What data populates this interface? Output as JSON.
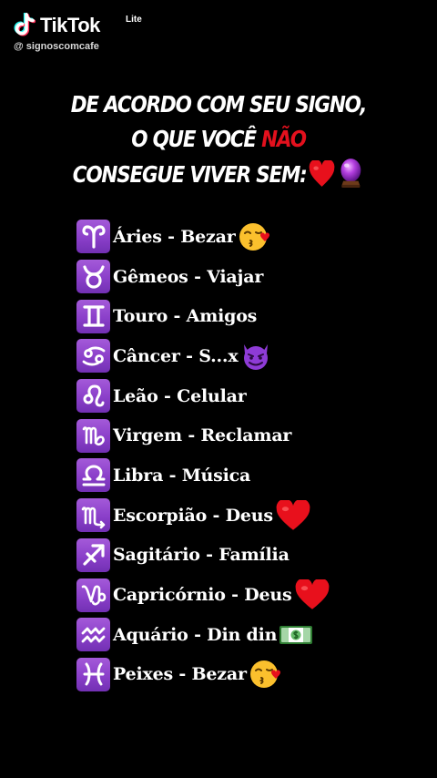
{
  "watermark": {
    "brand": "TikTok",
    "edition": "Lite",
    "handle": "@ signoscomcafe",
    "logo_icon": "tiktok-note-icon"
  },
  "headline": {
    "line1": "DE ACORDO COM SEU SIGNO,",
    "line2_prefix": "O QUE VOCÊ ",
    "line2_highlight": "NÃO",
    "line3": "CONSEGUE VIVER SEM:",
    "line3_emojis": [
      "red-heart-icon",
      "crystal-ball-icon"
    ],
    "highlight_color": "#e3101d"
  },
  "signs": [
    {
      "name": "Áries",
      "answer": "Bezar",
      "glyph": "aries-icon",
      "emoji": "kissing-face-icon"
    },
    {
      "name": "Gêmeos",
      "answer": "Viajar",
      "glyph": "taurus-icon",
      "emoji": ""
    },
    {
      "name": "Touro",
      "answer": "Amigos",
      "glyph": "gemini-icon",
      "emoji": ""
    },
    {
      "name": "Câncer",
      "answer": "S...x",
      "glyph": "cancer-icon",
      "emoji": "smiling-devil-icon"
    },
    {
      "name": "Leão",
      "answer": "Celular",
      "glyph": "leo-icon",
      "emoji": ""
    },
    {
      "name": "Virgem",
      "answer": "Reclamar",
      "glyph": "virgo-icon",
      "emoji": ""
    },
    {
      "name": "Libra",
      "answer": "Música",
      "glyph": "libra-icon",
      "emoji": ""
    },
    {
      "name": "Escorpião",
      "answer": "Deus",
      "glyph": "scorpio-icon",
      "emoji": "red-heart-icon"
    },
    {
      "name": "Sagitário",
      "answer": "Família",
      "glyph": "sagittarius-icon",
      "emoji": ""
    },
    {
      "name": "Capricórnio",
      "answer": "Deus",
      "glyph": "capricorn-icon",
      "emoji": "red-heart-icon"
    },
    {
      "name": "Aquário",
      "answer": "Din din",
      "glyph": "aquarius-icon",
      "emoji": "dollar-banknote-icon"
    },
    {
      "name": "Peixes",
      "answer": "Bezar",
      "glyph": "pisces-icon",
      "emoji": "kissing-face-icon"
    }
  ],
  "separator": " - ",
  "colors": {
    "background": "#000000",
    "text": "#ffffff",
    "badge": "#8a3fc9",
    "emphasis": "#e3101d"
  }
}
